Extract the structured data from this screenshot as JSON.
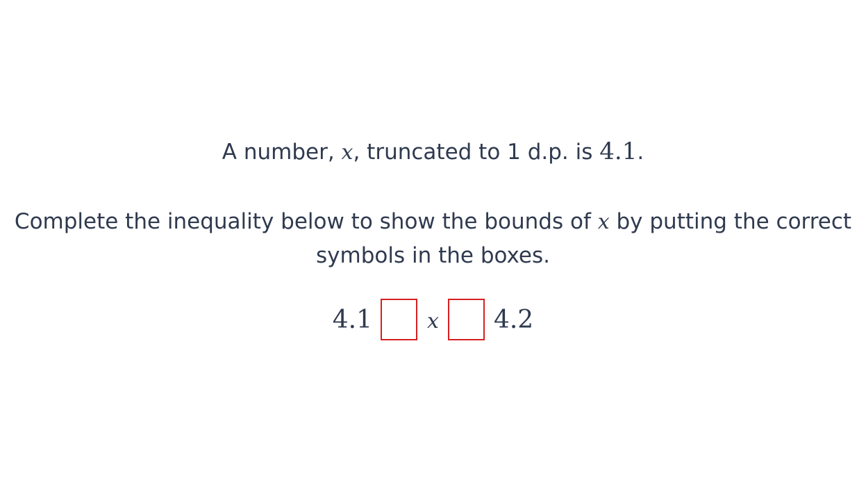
{
  "question": {
    "line1": {
      "part1": "A number,",
      "variable": "x",
      "part2": ", truncated to 1 d.p. is",
      "value": "4.1",
      "end": "."
    },
    "line2": {
      "part1": "Complete the inequality below to show the bounds of",
      "variable": "x",
      "part2": "by putting the correct symbols in the boxes."
    }
  },
  "inequality": {
    "lower": "4.1",
    "variable": "x",
    "upper": "4.2",
    "box_left_value": "",
    "box_right_value": ""
  },
  "colors": {
    "text": "#2f3a4f",
    "box_border": "#d61f1f",
    "background": "#ffffff"
  }
}
